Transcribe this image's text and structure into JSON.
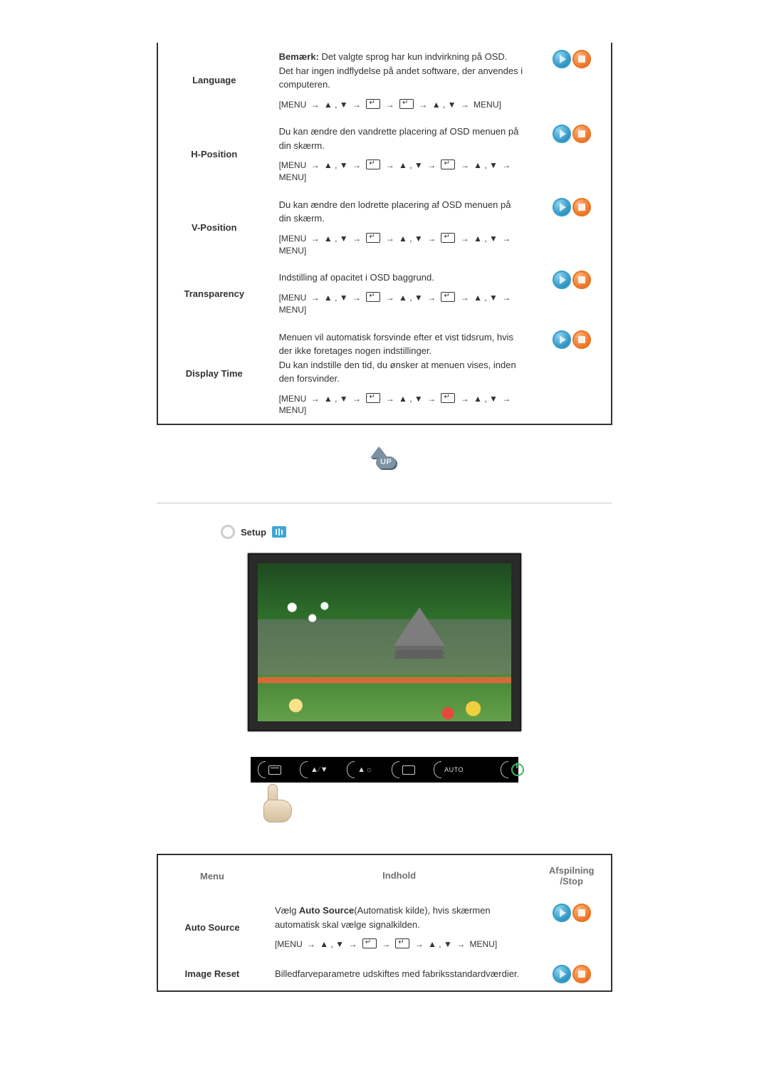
{
  "osd_table": {
    "rows": [
      {
        "menu": "Language",
        "content_html": "<b>Bemærk:</b> Det valgte sprog har kun indvirkning på OSD. Det har ingen indflydelse på andet software, der anvendes i computeren.",
        "sequence_type": "short"
      },
      {
        "menu": "H-Position",
        "content_html": "Du kan ændre den vandrette placering af OSD menuen på din skærm.",
        "sequence_type": "long"
      },
      {
        "menu": "V-Position",
        "content_html": "Du kan ændre den lodrette placering af OSD menuen på din skærm.",
        "sequence_type": "long"
      },
      {
        "menu": "Transparency",
        "content_html": "Indstilling af opacitet i OSD baggrund.",
        "sequence_type": "long"
      },
      {
        "menu": "Display Time",
        "content_html": "Menuen vil automatisk forsvinde efter et vist tidsrum, hvis der ikke foretages nogen indstillinger.<br>Du kan indstille den tid, du ønsker at menuen vises, inden den forsvinder.",
        "sequence_type": "long"
      }
    ]
  },
  "up": {
    "label": "UP"
  },
  "setup_section": {
    "title": "Setup"
  },
  "button_bar": {
    "buttons": [
      {
        "label": ""
      },
      {
        "label": ""
      },
      {
        "label": ""
      },
      {
        "label": ""
      },
      {
        "label": "AUTO"
      },
      {
        "label": ""
      }
    ]
  },
  "setup_table": {
    "headers": {
      "menu": "Menu",
      "content": "Indhold",
      "play": "Afspilning\n/Stop"
    },
    "rows": [
      {
        "menu": "Auto Source",
        "content_html": "Vælg <b>Auto Source</b>(Automatisk kilde), hvis skærmen automatisk skal vælge signalkilden.",
        "sequence_type": "short"
      },
      {
        "menu": "Image Reset",
        "content_html": "Billedfarveparametre udskiftes med fabriksstandardværdier.",
        "sequence_type": null
      }
    ]
  },
  "seq": {
    "menu": "MENU",
    "end": "MENU]",
    "start": "[MENU",
    "arrow": "→",
    "updown": "▲ , ▼"
  }
}
